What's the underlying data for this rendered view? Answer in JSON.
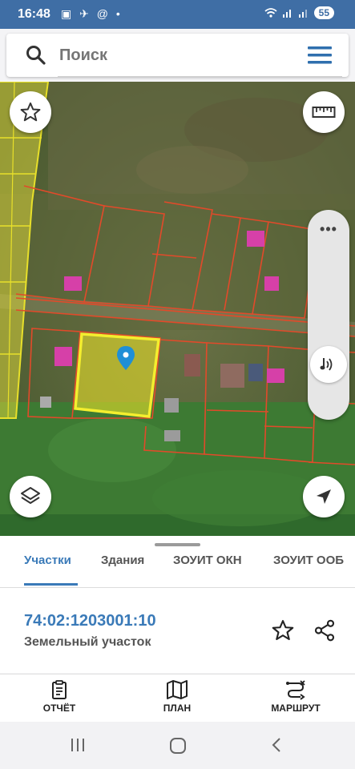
{
  "status_bar": {
    "time": "16:48",
    "left_icons": "▣ ✈ @ •",
    "battery": "55"
  },
  "search": {
    "placeholder": "Поиск",
    "icon": "search-icon",
    "menu_icon": "hamburger-menu-icon"
  },
  "map": {
    "buttons": [
      "star-icon",
      "ruler-icon",
      "layers-icon",
      "navigation-arrow-icon"
    ],
    "slider_icon": "volume-note-icon",
    "slider_menu": "•••"
  },
  "tabs": [
    {
      "label": "Участки",
      "active": true
    },
    {
      "label": "Здания",
      "active": false
    },
    {
      "label": "ЗОУИТ ОКН",
      "active": false
    },
    {
      "label": "ЗОУИТ ООБ",
      "active": false
    }
  ],
  "parcel": {
    "number": "74:02:1203001:10",
    "type": "Земельный участок"
  },
  "bottom_nav": [
    {
      "label": "ОТЧЁТ",
      "icon": "report-clipboard-icon"
    },
    {
      "label": "ПЛАН",
      "icon": "map-plan-icon"
    },
    {
      "label": "МАРШРУТ",
      "icon": "route-icon"
    }
  ],
  "colors": {
    "status_bar": "#3f6ea5",
    "accent": "#3a7ab8",
    "parcel_highlight": "#e8e02a",
    "parcel_border": "#e24a2a"
  }
}
